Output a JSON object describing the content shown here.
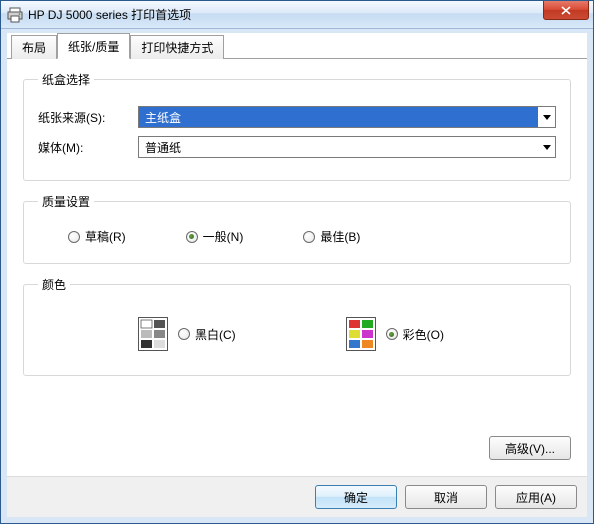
{
  "window": {
    "title": "HP DJ 5000 series 打印首选项"
  },
  "tabs": {
    "layout": "布局",
    "paper": "纸张/质量",
    "shortcut": "打印快捷方式",
    "active": "paper"
  },
  "tray": {
    "legend": "纸盒选择",
    "source_label": "纸张来源(S):",
    "source_value": "主纸盒",
    "media_label": "媒体(M):",
    "media_value": "普通纸"
  },
  "quality": {
    "legend": "质量设置",
    "draft": "草稿(R)",
    "normal": "一般(N)",
    "best": "最佳(B)",
    "selected": "normal"
  },
  "color": {
    "legend": "颜色",
    "bw": "黑白(C)",
    "color": "彩色(O)",
    "selected": "color"
  },
  "buttons": {
    "advanced": "高级(V)...",
    "ok": "确定",
    "cancel": "取消",
    "apply": "应用(A)"
  }
}
